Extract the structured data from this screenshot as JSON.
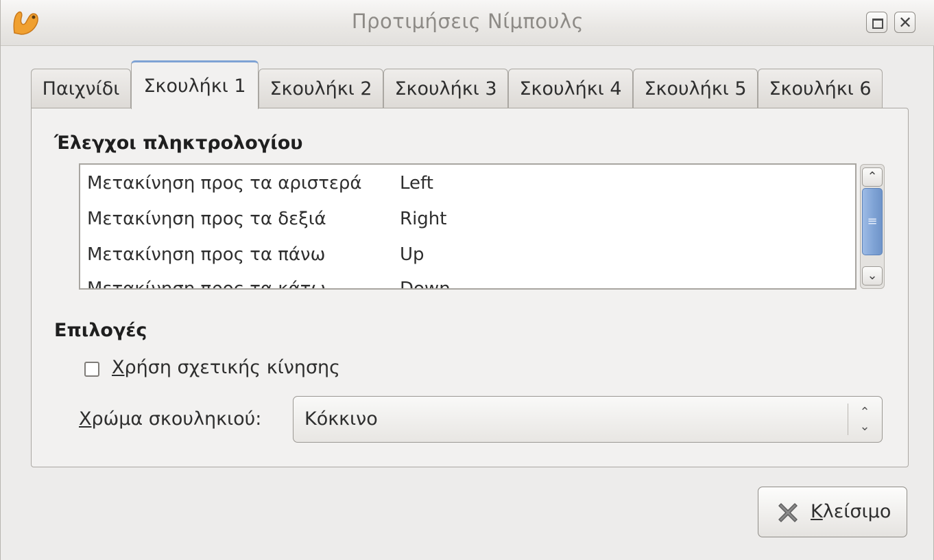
{
  "window": {
    "title": "Προτιμήσεις Νίμπουλς"
  },
  "tabs": [
    {
      "label": "Παιχνίδι"
    },
    {
      "label": "Σκουλήκι 1",
      "active": true
    },
    {
      "label": "Σκουλήκι 2"
    },
    {
      "label": "Σκουλήκι 3"
    },
    {
      "label": "Σκουλήκι 4"
    },
    {
      "label": "Σκουλήκι 5"
    },
    {
      "label": "Σκουλήκι 6"
    }
  ],
  "keyboard": {
    "heading": "Έλεγχοι πληκτρολογίου",
    "rows": [
      {
        "action": "Μετακίνηση προς τα αριστερά",
        "key": "Left"
      },
      {
        "action": "Μετακίνηση προς τα δεξιά",
        "key": "Right"
      },
      {
        "action": "Μετακίνηση προς τα πάνω",
        "key": "Up"
      },
      {
        "action": "Μετακίνηση προς τα κάτω",
        "key": "Down"
      }
    ]
  },
  "options": {
    "heading": "Επιλογές",
    "relative_move": {
      "mnemonic": "Χ",
      "rest": "ρήση σχετικής κίνησης",
      "checked": false
    },
    "color": {
      "mnemonic": "Χ",
      "rest": "ρώμα σκουληκιού:",
      "value": "Κόκκινο"
    }
  },
  "close_button": {
    "mnemonic": "Κ",
    "rest": "λείσιμο"
  },
  "icons": {
    "app": "nibbles-worm-icon",
    "close_button": "close-x-icon"
  },
  "colors": {
    "accent": "#7ea2d4",
    "app_icon": "#f0a030"
  }
}
